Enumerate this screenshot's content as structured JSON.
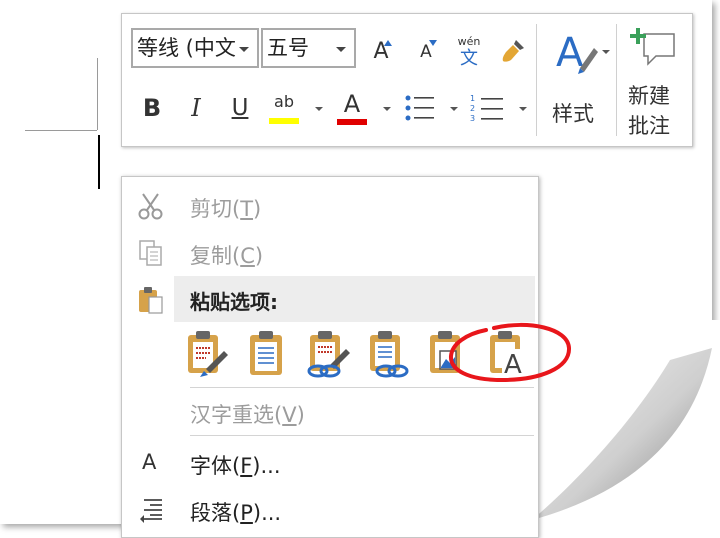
{
  "toolbar": {
    "font_name": "等线 (中文",
    "font_size": "五号",
    "grow_font_label": "A",
    "shrink_font_label": "A",
    "phonetic_top": "wén",
    "phonetic_bottom": "文",
    "bold_label": "B",
    "italic_label": "I",
    "underline_label": "U",
    "highlight_label": "ab",
    "font_color_label": "A",
    "styles_label": "样式",
    "new_comment_line1": "新建",
    "new_comment_line2": "批注",
    "highlight_color": "#ffff00",
    "font_color": "#e00000",
    "accent_color": "#2b6cc4"
  },
  "menu": {
    "cut_label": "剪切",
    "cut_key": "T",
    "copy_label": "复制",
    "copy_key": "C",
    "paste_header": "粘贴选项:",
    "reconvert_label": "汉字重选",
    "reconvert_key": "V",
    "font_label": "字体",
    "font_key": "F",
    "paragraph_label": "段落",
    "paragraph_key": "P",
    "ellipsis": "...",
    "font_icon_glyph": "A",
    "paste_text_only_glyph": "A",
    "highlight_ring_color": "#e8161b"
  }
}
